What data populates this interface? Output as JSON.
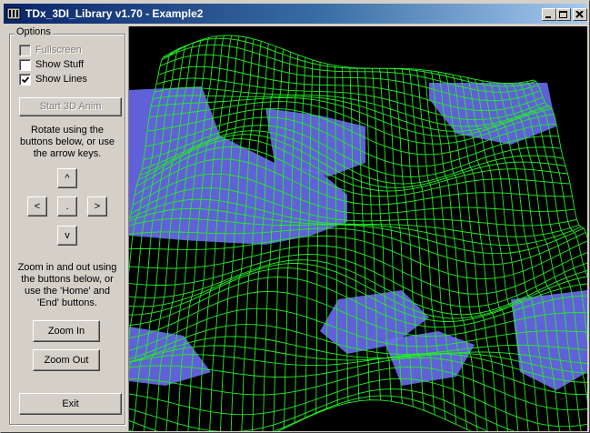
{
  "window": {
    "title": "TDx_3DI_Library v1.70 - Example2"
  },
  "titlebar_buttons": [
    {
      "icon": "minimize-icon"
    },
    {
      "icon": "maximize-icon"
    },
    {
      "icon": "close-icon"
    }
  ],
  "options": {
    "label": "Options",
    "fullscreen": {
      "label": "Fullscreen",
      "checked": false,
      "enabled": false
    },
    "show_stuff": {
      "label": "Show Stuff",
      "checked": false,
      "enabled": true
    },
    "show_lines": {
      "label": "Show Lines",
      "checked": true,
      "enabled": true
    },
    "start_anim": {
      "label": "Start 3D Anim",
      "enabled": false
    },
    "rotate_help": "Rotate using the buttons below, or use the arrow keys.",
    "rotate": {
      "up": "^",
      "left": "<",
      "center": ".",
      "right": ">",
      "down": "v"
    },
    "zoom_help": "Zoom in and out using the buttons below, or use the 'Home' and 'End' buttons.",
    "zoom_in": "Zoom In",
    "zoom_out": "Zoom Out",
    "exit": "Exit"
  },
  "scene": {
    "background": "#000000",
    "mesh_color": "#22ee22",
    "water_color": "#6a6cf0"
  }
}
